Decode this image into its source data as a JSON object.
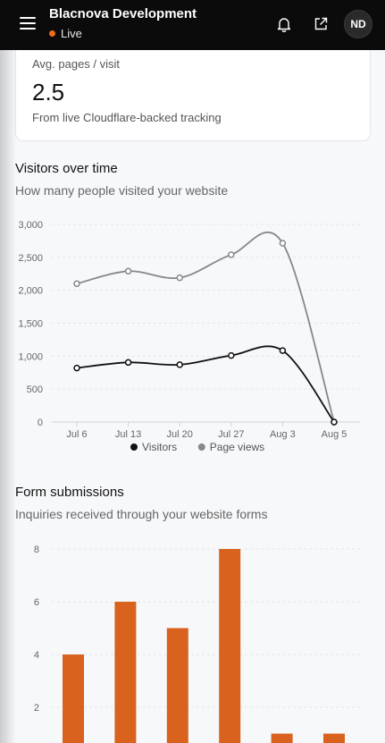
{
  "header": {
    "app_title": "Blacnova Development",
    "status_label": "Live",
    "avatar_initials": "ND",
    "icons": [
      "menu-icon",
      "bell-icon",
      "external-link-icon"
    ],
    "colors": {
      "background": "#0b0b0b",
      "status_dot": "#f26b1d"
    }
  },
  "stat_card": {
    "label": "Avg. pages / visit",
    "value": "2.5",
    "subtitle": "From live Cloudflare-backed tracking"
  },
  "visitors_section": {
    "title": "Visitors over time",
    "subtitle": "How many people visited your website"
  },
  "forms_section": {
    "title": "Form submissions",
    "subtitle": "Inquiries received through your website forms"
  },
  "chart_data": [
    {
      "type": "line",
      "categories": [
        "Jul 6",
        "Jul 13",
        "Jul 20",
        "Jul 27",
        "Aug 3",
        "Aug 5"
      ],
      "series": [
        {
          "name": "Visitors",
          "values": [
            820,
            905,
            870,
            1010,
            1085,
            0
          ],
          "color": "#111111"
        },
        {
          "name": "Page views",
          "values": [
            2100,
            2290,
            2190,
            2540,
            2715,
            0
          ],
          "color": "#888888"
        }
      ],
      "yticks": [
        "3,000",
        "2,500",
        "2,000",
        "1,500",
        "1,000",
        "500",
        "0"
      ],
      "ytick_values": [
        3000,
        2500,
        2000,
        1500,
        1000,
        500,
        0
      ],
      "ylim": [
        0,
        3000
      ],
      "legend": "bottom-center",
      "grid": true
    },
    {
      "type": "bar",
      "values": [
        4,
        6,
        5,
        8,
        1,
        1
      ],
      "yticks": [
        "8",
        "6",
        "4",
        "2"
      ],
      "ytick_values": [
        8,
        6,
        4,
        2
      ],
      "ylim": [
        0,
        8
      ],
      "color": "#d9621e",
      "grid": true
    }
  ]
}
